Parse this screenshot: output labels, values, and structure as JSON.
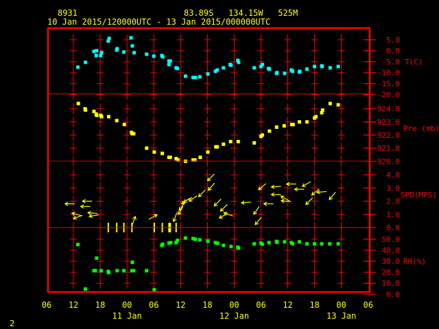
{
  "header": {
    "station_id": "8931",
    "location": "83.89S   134.15W   525M",
    "time_range": "10 Jan 2015/120000UTC - 13 Jan 2015/000000UTC"
  },
  "footer": {
    "page_number": "2"
  },
  "colors": {
    "frame": "#ff0000",
    "text": "#ffff00",
    "temperature": "#00ffff",
    "pressure": "#ffff00",
    "wind": "#ffff00",
    "rh": "#00ff00"
  },
  "chart_data": {
    "type": "scatter",
    "x_units": "hours since 10 Jan 2015 06 UTC",
    "xlim": [
      0,
      72
    ],
    "x_ticks": [
      {
        "h": 0,
        "label": "06"
      },
      {
        "h": 6,
        "label": "12"
      },
      {
        "h": 12,
        "label": "18"
      },
      {
        "h": 18,
        "label": "00"
      },
      {
        "h": 24,
        "label": "06"
      },
      {
        "h": 30,
        "label": "12"
      },
      {
        "h": 36,
        "label": "18"
      },
      {
        "h": 42,
        "label": "00"
      },
      {
        "h": 48,
        "label": "06"
      },
      {
        "h": 54,
        "label": "12"
      },
      {
        "h": 60,
        "label": "18"
      },
      {
        "h": 66,
        "label": "00"
      },
      {
        "h": 72,
        "label": "06"
      }
    ],
    "day_labels": [
      {
        "h": 18,
        "label": "11 Jan"
      },
      {
        "h": 42,
        "label": "12 Jan"
      },
      {
        "h": 66,
        "label": "13 Jan"
      }
    ],
    "panels": [
      {
        "key": "temperature",
        "label": "T(C)",
        "ylim": [
          -20,
          5
        ],
        "ticks": [
          {
            "v": 5,
            "label": "5.0"
          },
          {
            "v": 0,
            "label": "0.0"
          },
          {
            "v": -5,
            "label": "-5.0"
          },
          {
            "v": -10,
            "label": "-10.0"
          },
          {
            "v": -15,
            "label": "-15.0"
          },
          {
            "v": -20,
            "label": "-20.0"
          }
        ],
        "points": [
          [
            7.0,
            -7.5
          ],
          [
            8.7,
            -5.3
          ],
          [
            10.6,
            -0.3
          ],
          [
            11.2,
            0
          ],
          [
            11.1,
            -2.2
          ],
          [
            12.1,
            -2.2
          ],
          [
            12.3,
            -0.9
          ],
          [
            13.8,
            4.4
          ],
          [
            14.0,
            5.6
          ],
          [
            15.7,
            0.3
          ],
          [
            15.8,
            0.9
          ],
          [
            17.3,
            -0.6
          ],
          [
            18.9,
            5.9
          ],
          [
            19.2,
            2.2
          ],
          [
            19.6,
            -0.9
          ],
          [
            22.4,
            -1.6
          ],
          [
            24.0,
            -2.5
          ],
          [
            25.8,
            -2.2
          ],
          [
            26.0,
            -2.8
          ],
          [
            27.4,
            -4.7
          ],
          [
            27.7,
            -4.7
          ],
          [
            27.4,
            -6.3
          ],
          [
            29.0,
            -7.8
          ],
          [
            29.3,
            -8.1
          ],
          [
            31.1,
            -11.6
          ],
          [
            32.8,
            -12.2
          ],
          [
            33.3,
            -12.2
          ],
          [
            34.3,
            -11.9
          ],
          [
            36.1,
            -10.6
          ],
          [
            37.8,
            -9.4
          ],
          [
            38.2,
            -8.8
          ],
          [
            39.6,
            -7.8
          ],
          [
            41.1,
            -6.3
          ],
          [
            41.3,
            -6.6
          ],
          [
            42.8,
            -4.4
          ],
          [
            43.0,
            -5.3
          ],
          [
            46.5,
            -7.8
          ],
          [
            48.0,
            -7.2
          ],
          [
            48.3,
            -6.3
          ],
          [
            49.7,
            -8.1
          ],
          [
            49.9,
            -8.4
          ],
          [
            51.5,
            -10.3
          ],
          [
            51.6,
            -10.0
          ],
          [
            53.3,
            -10.3
          ],
          [
            54.8,
            -8.8
          ],
          [
            55.1,
            -9.4
          ],
          [
            56.6,
            -9.7
          ],
          [
            56.7,
            -9.4
          ],
          [
            58.3,
            -8.4
          ],
          [
            60.0,
            -7.2
          ],
          [
            61.6,
            -6.9
          ],
          [
            61.7,
            -7.2
          ],
          [
            63.5,
            -7.8
          ],
          [
            65.3,
            -7.2
          ]
        ]
      },
      {
        "key": "pressure",
        "label": "Pre (mb)",
        "ylim": [
          920,
          925
        ],
        "ticks": [
          {
            "v": 924,
            "label": "924.0"
          },
          {
            "v": 923,
            "label": "923.0"
          },
          {
            "v": 922,
            "label": "922.0"
          },
          {
            "v": 921,
            "label": "921.0"
          },
          {
            "v": 920,
            "label": "920.0"
          }
        ],
        "points": [
          [
            7.1,
            924.4
          ],
          [
            8.6,
            924.0
          ],
          [
            8.7,
            923.9
          ],
          [
            10.6,
            923.8
          ],
          [
            11.1,
            923.6
          ],
          [
            11.2,
            923.5
          ],
          [
            12.1,
            923.5
          ],
          [
            12.3,
            923.4
          ],
          [
            13.9,
            923.4
          ],
          [
            15.7,
            923.1
          ],
          [
            17.4,
            922.8
          ],
          [
            19.0,
            922.2
          ],
          [
            19.2,
            922.1
          ],
          [
            19.5,
            922.1
          ],
          [
            22.4,
            921.0
          ],
          [
            24.1,
            920.7
          ],
          [
            25.9,
            920.6
          ],
          [
            27.4,
            920.3
          ],
          [
            27.7,
            920.3
          ],
          [
            29.0,
            920.2
          ],
          [
            29.4,
            920.1
          ],
          [
            31.1,
            920.0
          ],
          [
            32.8,
            920.1
          ],
          [
            33.2,
            920.1
          ],
          [
            34.4,
            920.3
          ],
          [
            36.1,
            920.7
          ],
          [
            37.9,
            921.1
          ],
          [
            38.2,
            921.1
          ],
          [
            39.6,
            921.3
          ],
          [
            41.2,
            921.5
          ],
          [
            42.9,
            921.5
          ],
          [
            46.5,
            921.4
          ],
          [
            48.0,
            921.9
          ],
          [
            48.3,
            922.0
          ],
          [
            49.9,
            922.3
          ],
          [
            51.5,
            922.6
          ],
          [
            53.2,
            922.7
          ],
          [
            54.9,
            922.8
          ],
          [
            55.2,
            922.8
          ],
          [
            56.6,
            923.0
          ],
          [
            58.3,
            923.0
          ],
          [
            60.0,
            923.3
          ],
          [
            60.3,
            923.4
          ],
          [
            61.6,
            923.7
          ],
          [
            61.8,
            923.9
          ],
          [
            63.5,
            924.4
          ],
          [
            65.3,
            924.3
          ]
        ]
      },
      {
        "key": "wind",
        "label": "SPD(MPS)",
        "ylim": [
          0,
          5
        ],
        "ticks": [
          {
            "v": 4,
            "label": "4.0"
          },
          {
            "v": 3,
            "label": "3.0"
          },
          {
            "v": 2,
            "label": "2.0"
          },
          {
            "v": 1,
            "label": "1.0"
          },
          {
            "v": 0,
            "label": "0.0"
          }
        ],
        "points_note": "[hours, speed m/s, arrow bearing degrees]",
        "points": [
          [
            5.2,
            1.8,
            270
          ],
          [
            6.7,
            1.0,
            285
          ],
          [
            7.0,
            0.8,
            250
          ],
          [
            8.7,
            1.6,
            270
          ],
          [
            9.1,
            2.0,
            270
          ],
          [
            10.3,
            1.1,
            275
          ],
          [
            10.6,
            0.9,
            260
          ],
          [
            19.5,
            0.5,
            20
          ],
          [
            23.8,
            0.8,
            60
          ],
          [
            28.8,
            0.8,
            200
          ],
          [
            30.0,
            1.3,
            210
          ],
          [
            30.3,
            1.6,
            215
          ],
          [
            31.1,
            2.0,
            235
          ],
          [
            31.6,
            2.1,
            240
          ],
          [
            32.8,
            2.2,
            235
          ],
          [
            34.8,
            2.6,
            225
          ],
          [
            36.8,
            3.8,
            225
          ],
          [
            36.9,
            3.1,
            220
          ],
          [
            38.3,
            1.9,
            225
          ],
          [
            39.7,
            1.5,
            225
          ],
          [
            39.6,
            0.9,
            240
          ],
          [
            40.7,
            1.0,
            290
          ],
          [
            44.7,
            1.9,
            265
          ],
          [
            47.0,
            1.3,
            215
          ],
          [
            47.4,
            0.5,
            220
          ],
          [
            48.3,
            3.1,
            230
          ],
          [
            49.7,
            1.8,
            270
          ],
          [
            51.4,
            3.1,
            265
          ],
          [
            51.4,
            2.5,
            270
          ],
          [
            53.4,
            2.2,
            300
          ],
          [
            53.6,
            2.0,
            275
          ],
          [
            54.8,
            3.3,
            270
          ],
          [
            56.6,
            2.9,
            270
          ],
          [
            58.2,
            3.3,
            240
          ],
          [
            58.8,
            2.0,
            225
          ],
          [
            60.2,
            2.7,
            230
          ],
          [
            61.6,
            2.7,
            265
          ],
          [
            64.0,
            2.4,
            220
          ]
        ],
        "calm_hours": [
          13.8,
          15.7,
          17.3,
          19.1,
          24.1,
          25.9,
          27.4,
          27.7,
          29.0
        ]
      },
      {
        "key": "rh",
        "label": "RH(%)",
        "ylim": [
          0,
          55
        ],
        "ticks": [
          {
            "v": 50,
            "label": "50.0"
          },
          {
            "v": 40,
            "label": "40.0"
          },
          {
            "v": 30,
            "label": "30.0"
          },
          {
            "v": 20,
            "label": "20.0"
          },
          {
            "v": 10,
            "label": "10.0"
          },
          {
            "v": 0,
            "label": "0.0"
          }
        ],
        "points": [
          [
            7.0,
            45.2
          ],
          [
            8.7,
            4.7
          ],
          [
            11.2,
            32.8
          ],
          [
            10.6,
            21.4
          ],
          [
            10.9,
            21.4
          ],
          [
            12.2,
            21.4
          ],
          [
            13.8,
            20.7
          ],
          [
            13.9,
            19.7
          ],
          [
            15.8,
            21.4
          ],
          [
            17.3,
            21.4
          ],
          [
            19.2,
            29.0
          ],
          [
            19.1,
            21.4
          ],
          [
            19.5,
            21.4
          ],
          [
            22.4,
            21.4
          ],
          [
            24.1,
            4.1
          ],
          [
            25.8,
            44.4
          ],
          [
            26.0,
            45.5
          ],
          [
            27.4,
            46.5
          ],
          [
            27.8,
            46.9
          ],
          [
            29.0,
            46.9
          ],
          [
            29.3,
            48.9
          ],
          [
            31.1,
            51.1
          ],
          [
            32.8,
            50.6
          ],
          [
            33.3,
            50.0
          ],
          [
            34.3,
            49.4
          ],
          [
            36.1,
            48.1
          ],
          [
            37.8,
            46.9
          ],
          [
            38.3,
            46.3
          ],
          [
            39.6,
            44.4
          ],
          [
            41.3,
            43.3
          ],
          [
            42.8,
            42.7
          ],
          [
            43.0,
            41.9
          ],
          [
            46.5,
            45.8
          ],
          [
            48.0,
            46.4
          ],
          [
            48.3,
            45.5
          ],
          [
            49.8,
            46.9
          ],
          [
            51.5,
            48.0
          ],
          [
            51.6,
            47.3
          ],
          [
            53.3,
            47.6
          ],
          [
            54.8,
            46.9
          ],
          [
            55.1,
            45.9
          ],
          [
            56.6,
            47.6
          ],
          [
            58.3,
            45.8
          ],
          [
            60.0,
            45.8
          ],
          [
            61.6,
            45.8
          ],
          [
            63.4,
            45.8
          ],
          [
            65.3,
            45.8
          ]
        ]
      }
    ]
  }
}
